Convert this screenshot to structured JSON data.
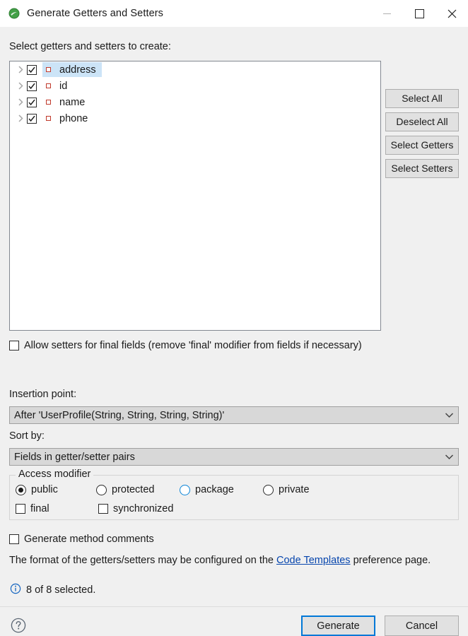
{
  "window": {
    "title": "Generate Getters and Setters",
    "app_icon": "eclipse-icon",
    "controls": {
      "minimize": "minimize-icon",
      "maximize": "maximize-icon",
      "close": "close-icon"
    }
  },
  "main": {
    "intro_label": "Select getters and setters to create:",
    "tree": {
      "items": [
        {
          "label": "address",
          "checked": true,
          "selected": true,
          "icon": "private-field-icon",
          "expandable": true
        },
        {
          "label": "id",
          "checked": true,
          "selected": false,
          "icon": "private-field-icon",
          "expandable": true
        },
        {
          "label": "name",
          "checked": true,
          "selected": false,
          "icon": "private-field-icon",
          "expandable": true
        },
        {
          "label": "phone",
          "checked": true,
          "selected": false,
          "icon": "private-field-icon",
          "expandable": true
        }
      ]
    },
    "side_buttons": [
      {
        "label": "Select All"
      },
      {
        "label": "Deselect All"
      },
      {
        "label": "Select Getters"
      },
      {
        "label": "Select Setters"
      }
    ],
    "allow_final": {
      "label": "Allow setters for final fields (remove 'final' modifier from fields if necessary)",
      "checked": false
    },
    "insertion_point": {
      "label": "Insertion point:",
      "value": "After 'UserProfile(String, String, String, String)'"
    },
    "sort_by": {
      "label": "Sort by:",
      "value": "Fields in getter/setter pairs"
    },
    "access_modifier": {
      "title": "Access modifier",
      "radios": [
        {
          "label": "public",
          "selected": true,
          "hover": false
        },
        {
          "label": "protected",
          "selected": false,
          "hover": false
        },
        {
          "label": "package",
          "selected": false,
          "hover": true
        },
        {
          "label": "private",
          "selected": false,
          "hover": false
        }
      ],
      "checkboxes": [
        {
          "label": "final",
          "checked": false
        },
        {
          "label": "synchronized",
          "checked": false
        }
      ]
    },
    "generate_comments": {
      "label": "Generate method comments",
      "checked": false
    },
    "format_note": {
      "prefix": "The format of the getters/setters may be configured on the ",
      "link": "Code Templates",
      "suffix": " preference page."
    },
    "status": {
      "icon": "info-icon",
      "text": "8 of 8 selected."
    }
  },
  "footer": {
    "help_icon": "help-icon",
    "generate_label": "Generate",
    "cancel_label": "Cancel"
  },
  "colors": {
    "dialog_bg": "#f0f0f0",
    "selection_blue": "#cce4f7",
    "focus_blue": "#0078d7",
    "link_blue": "#0645ad",
    "field_icon_red": "#c0392b"
  }
}
